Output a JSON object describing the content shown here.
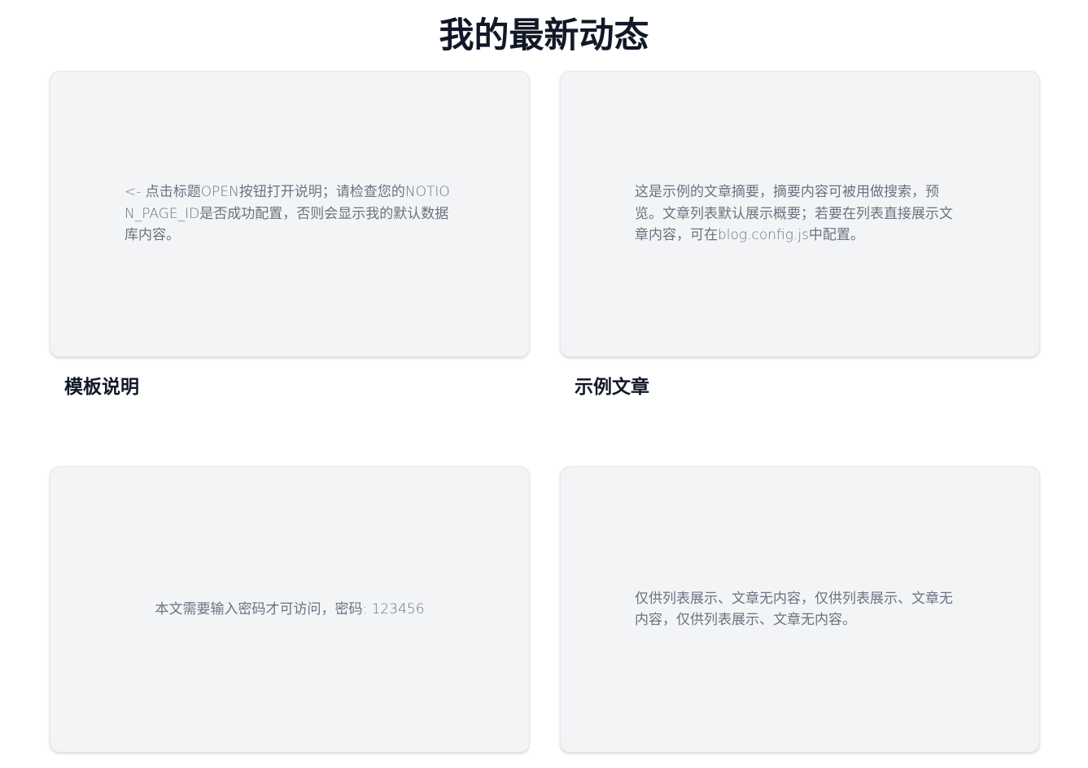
{
  "page": {
    "title": "我的最新动态"
  },
  "posts": [
    {
      "title": "模板说明",
      "summary": "<- 点击标题OPEN按钮打开说明；请检查您的NOTION_PAGE_ID是否成功配置，否则会显示我的默认数据库内容。"
    },
    {
      "title": "示例文章",
      "summary": "这是示例的文章摘要，摘要内容可被用做搜索，预览。文章列表默认展示概要；若要在列表直接展示文章内容，可在blog.config.js中配置。"
    },
    {
      "title": "",
      "summary": "本文需要输入密码才可访问，密码: 123456"
    },
    {
      "title": "",
      "summary": "仅供列表展示、文章无内容，仅供列表展示、文章无内容，仅供列表展示、文章无内容。"
    }
  ],
  "colors": {
    "card_background": "#f3f4f6",
    "summary_text": "#6b7280",
    "title_text": "#111827"
  }
}
